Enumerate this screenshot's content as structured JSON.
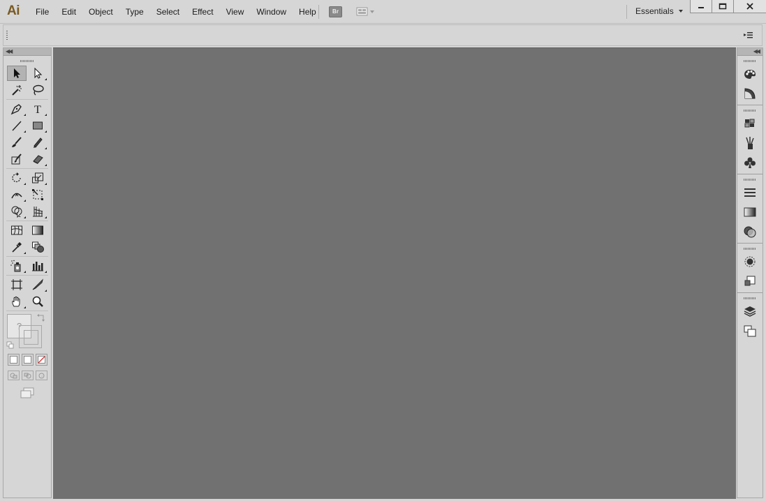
{
  "app": {
    "logo": "Ai",
    "menu": [
      "File",
      "Edit",
      "Object",
      "Type",
      "Select",
      "Effect",
      "View",
      "Window",
      "Help"
    ],
    "bridge_label": "Br",
    "arrange_documents_icon": "arrange-documents-icon",
    "workspace": "Essentials"
  },
  "window_controls": [
    "minimize-icon",
    "maximize-icon",
    "close-icon"
  ],
  "tools_panel": {
    "rows": [
      [
        "selection-tool-icon",
        "direct-selection-tool-icon"
      ],
      [
        "magic-wand-tool-icon",
        "lasso-tool-icon"
      ],
      [
        "pen-tool-icon",
        "type-tool-icon"
      ],
      [
        "line-segment-tool-icon",
        "rectangle-tool-icon"
      ],
      [
        "paintbrush-tool-icon",
        "pencil-tool-icon"
      ],
      [
        "blob-brush-tool-icon",
        "eraser-tool-icon"
      ],
      [
        "rotate-tool-icon",
        "scale-tool-icon"
      ],
      [
        "width-tool-icon",
        "free-transform-tool-icon"
      ],
      [
        "shape-builder-tool-icon",
        "perspective-grid-tool-icon"
      ],
      [
        "mesh-tool-icon",
        "gradient-tool-icon"
      ],
      [
        "eyedropper-tool-icon",
        "blend-tool-icon"
      ],
      [
        "symbol-sprayer-tool-icon",
        "column-graph-tool-icon"
      ],
      [
        "artboard-tool-icon",
        "slice-tool-icon"
      ],
      [
        "hand-tool-icon",
        "zoom-tool-icon"
      ]
    ],
    "fill_stroke_glyph": "?",
    "color_mode_buttons": [
      "color-icon",
      "gradient-icon",
      "none-icon"
    ],
    "draw_mode_buttons": [
      "draw-normal-icon",
      "draw-behind-icon",
      "draw-inside-icon"
    ],
    "screen_mode_icon": "screen-mode-icon"
  },
  "panel_dock": {
    "groups": [
      [
        "color-panel-icon",
        "color-guide-panel-icon"
      ],
      [
        "swatches-panel-icon",
        "brushes-panel-icon",
        "symbols-panel-icon"
      ],
      [
        "stroke-panel-icon",
        "gradient-panel-icon",
        "transparency-panel-icon"
      ],
      [
        "appearance-panel-icon",
        "graphic-styles-panel-icon"
      ],
      [
        "layers-panel-icon",
        "artboards-panel-icon"
      ]
    ]
  },
  "colors": {
    "chrome": "#d6d6d6",
    "canvas": "#717171",
    "logo": "#7a5a22"
  }
}
